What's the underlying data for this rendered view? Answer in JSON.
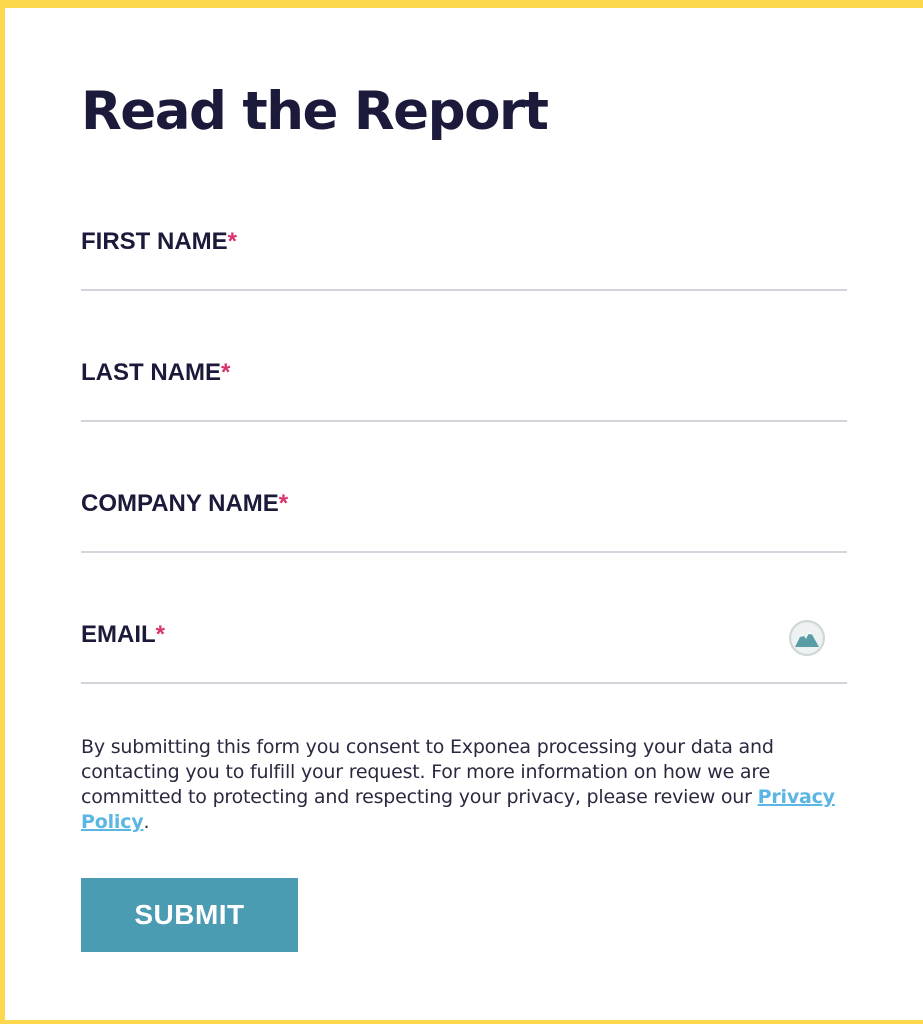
{
  "form": {
    "title": "Read the Report",
    "required_marker": "*",
    "fields": [
      {
        "label": "FIRST NAME",
        "value": ""
      },
      {
        "label": "LAST NAME",
        "value": ""
      },
      {
        "label": "COMPANY NAME",
        "value": ""
      },
      {
        "label": "EMAIL",
        "value": ""
      }
    ],
    "consent": {
      "text": "By submitting this form you consent to Exponea processing your data and contacting you to fulfill your request. For more information on how we are committed to protecting and respecting your privacy, please review our ",
      "link_text": "Privacy Policy",
      "suffix": "."
    },
    "submit_label": "SUBMIT"
  },
  "icons": {
    "email_autofill": "autofill-mountain-icon"
  },
  "colors": {
    "page_border": "#fbd84c",
    "background": "#ffffff",
    "title": "#1c1a3a",
    "required": "#d6336c",
    "link": "#5bb6e3",
    "button": "#4b9cb3",
    "divider": "#d3d4dc"
  }
}
